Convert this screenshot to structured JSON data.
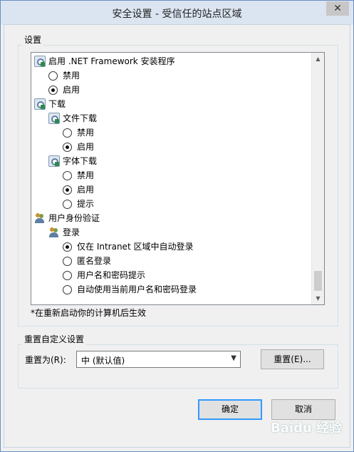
{
  "window": {
    "title": "安全设置 - 受信任的站点区域",
    "close_glyph": "✕"
  },
  "settings_group": {
    "legend": "设置"
  },
  "tree": {
    "net_framework": {
      "label": "启用 .NET Framework 安装程序",
      "options": [
        "禁用",
        "启用"
      ],
      "selected": 1
    },
    "download": {
      "label": "下载",
      "file_download": {
        "label": "文件下载",
        "options": [
          "禁用",
          "启用"
        ],
        "selected": 1
      },
      "font_download": {
        "label": "字体下载",
        "options": [
          "禁用",
          "启用",
          "提示"
        ],
        "selected": 1
      }
    },
    "user_auth": {
      "label": "用户身份验证",
      "logon": {
        "label": "登录",
        "options": [
          "仅在 Intranet 区域中自动登录",
          "匿名登录",
          "用户名和密码提示",
          "自动使用当前用户名和密码登录"
        ],
        "selected": 0
      }
    }
  },
  "note": "*在重新启动你的计算机后生效",
  "reset_group": {
    "legend": "重置自定义设置",
    "reset_to_label": "重置为(R):",
    "select_value": "中 (默认值)",
    "reset_button": "重置(E)..."
  },
  "footer": {
    "ok": "确定",
    "cancel": "取消"
  },
  "watermark": "Baidu 经验",
  "icons": {
    "setting": "settings-gear-icon",
    "users": "users-icon",
    "dropdown": "chevron-down-icon",
    "scroll_up": "scroll-up-arrow-icon",
    "scroll_down": "scroll-down-arrow-icon"
  },
  "colors": {
    "accent": "#3399ff",
    "titlebar": "#dbe5f1",
    "background": "#f0f0f0"
  }
}
